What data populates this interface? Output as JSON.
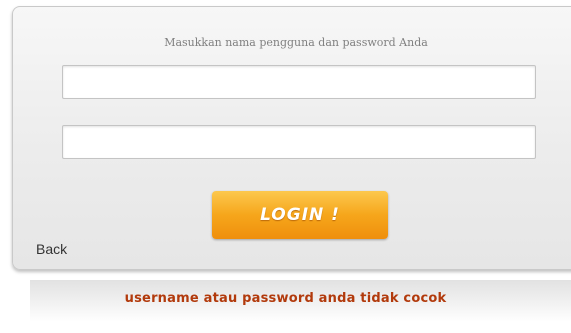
{
  "login": {
    "instruction": "Masukkan nama pengguna dan password Anda",
    "username_value": "",
    "password_value": "",
    "login_label": "LOGIN !",
    "back_label": "Back"
  },
  "error": {
    "message": "username atau password anda tidak cocok"
  },
  "colors": {
    "button_accent": "#f6a61b",
    "error_text": "#b23a0c"
  }
}
